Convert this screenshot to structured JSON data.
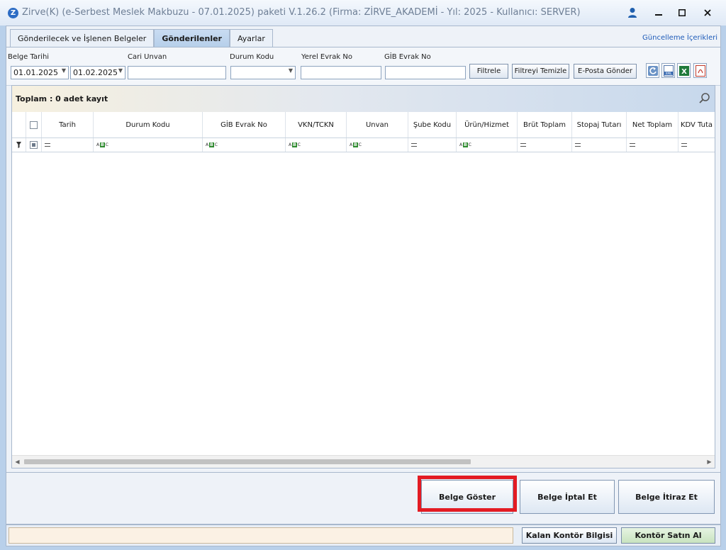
{
  "window": {
    "app_icon": "Z",
    "title": "Zirve(K)  (e-Serbest Meslek Makbuzu - 07.01.2025) paketi V.1.26.2 (Firma: ZİRVE_AKADEMİ - Yıl: 2025 - Kullanıcı: SERVER)",
    "icons": {
      "user": "user-icon",
      "minimize": "minimize-icon",
      "maximize": "maximize-icon",
      "close": "close-icon"
    }
  },
  "tabs": [
    {
      "label": "Gönderilecek ve İşlenen Belgeler",
      "active": false
    },
    {
      "label": "Gönderilenler",
      "active": true
    },
    {
      "label": "Ayarlar",
      "active": false
    }
  ],
  "update_link": "Güncelleme İçerikleri",
  "filters": {
    "belge_tarihi_label": "Belge Tarihi",
    "date_from": "01.01.2025",
    "date_to": "01.02.2025",
    "cari_unvan_label": "Cari Unvan",
    "cari_unvan_value": "",
    "durum_kodu_label": "Durum Kodu",
    "durum_kodu_value": "",
    "yerel_evrak_label": "Yerel Evrak No",
    "yerel_evrak_value": "",
    "gib_evrak_label": "GİB Evrak No",
    "gib_evrak_value": "",
    "buttons": {
      "filter": "Filtrele",
      "clear": "Filtreyi Temizle",
      "email": "E-Posta Gönder"
    },
    "export_icons": [
      "refresh-icon",
      "xml-export-icon",
      "excel-export-icon",
      "pdf-export-icon"
    ]
  },
  "grid": {
    "total_label": "Toplam : 0 adet kayıt",
    "columns": [
      "Tarih",
      "Durum Kodu",
      "GİB Evrak No",
      "VKN/TCKN",
      "Unvan",
      "Şube Kodu",
      "Ürün/Hizmet",
      "Brüt Toplam",
      "Stopaj Tutarı",
      "Net Toplam",
      "KDV Tuta"
    ],
    "filter_types": [
      "equals",
      "text",
      "text",
      "text",
      "text",
      "equals",
      "text",
      "equals",
      "equals",
      "equals",
      "equals"
    ],
    "rows": []
  },
  "actions": {
    "show": "Belge Göster",
    "cancel": "Belge İptal Et",
    "object": "Belge İtiraz Et"
  },
  "status": {
    "message": "",
    "credit_info": "Kalan Kontör Bilgisi",
    "buy_credit": "Kontör Satın Al"
  },
  "colors": {
    "highlight": "#e31b23",
    "accent": "#2d6cc4",
    "buy_button": "#d6ecd0"
  }
}
